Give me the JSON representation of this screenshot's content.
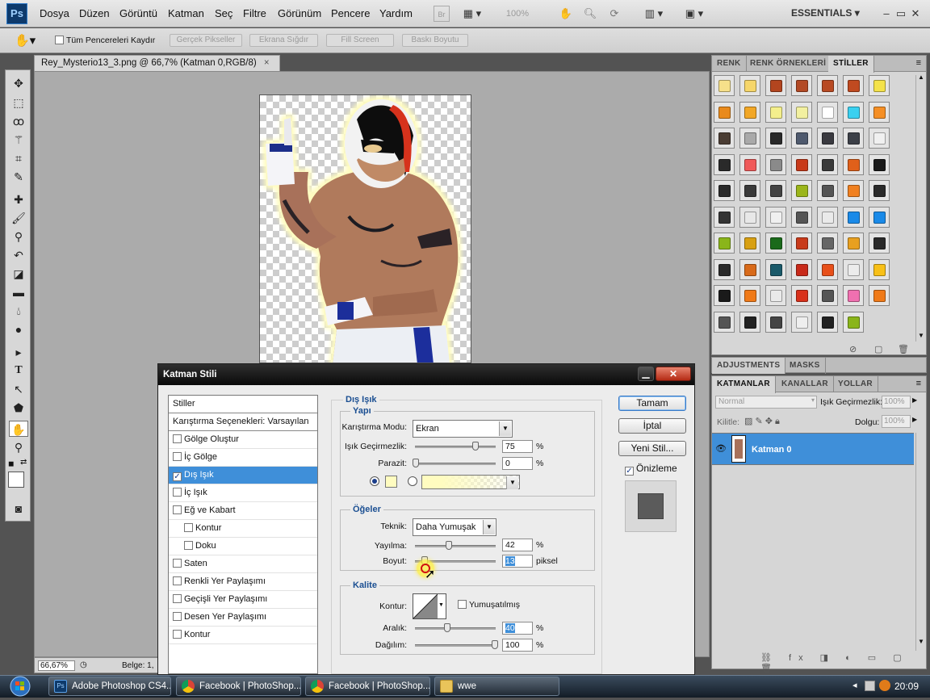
{
  "app": {
    "logo": "Ps",
    "menu": [
      "Dosya",
      "Düzen",
      "Görüntü",
      "Katman",
      "Seç",
      "Filtre",
      "Görünüm",
      "Pencere",
      "Yardım"
    ],
    "bridge_icon": "Br",
    "zoom_display": "100%",
    "workspace": "ESSENTIALS",
    "window_controls": [
      "–",
      "▭",
      "✕"
    ]
  },
  "options_bar": {
    "scroll_all_label": "Tüm Pencereleri Kaydır",
    "buttons": [
      "Gerçek Pikseller",
      "Ekrana Sığdır",
      "Fill Screen",
      "Baskı Boyutu"
    ]
  },
  "document": {
    "tab_title": "Rey_Mysterio13_3.png @ 66,7% (Katman 0,RGB/8)",
    "status_zoom": "66,67%",
    "status_doc": "Belge: 1,"
  },
  "tools": [
    "move-icon",
    "marquee-icon",
    "lasso-icon",
    "magic-wand-icon",
    "crop-icon",
    "eyedropper-icon",
    "healing-icon",
    "brush-icon",
    "stamp-icon",
    "history-brush-icon",
    "eraser-icon",
    "gradient-icon",
    "blur-icon",
    "dodge-icon",
    "pen-icon",
    "type-icon",
    "path-select-icon",
    "shape-icon",
    "hand-icon",
    "zoom-icon"
  ],
  "colors": {
    "foreground": "#ffffff",
    "background": "#ff00ff",
    "selection_blue": "#3f8fd9",
    "glow_color": "#fffcc0"
  },
  "styles_panel": {
    "tabs": [
      "RENK",
      "RENK ÖRNEKLERİ",
      "STİLLER"
    ],
    "active_tab": "STİLLER"
  },
  "adjustments_panel": {
    "tabs": [
      "ADJUSTMENTS",
      "MASKS"
    ]
  },
  "layers_panel": {
    "tabs": [
      "KATMANLAR",
      "KANALLAR",
      "YOLLAR"
    ],
    "blend_mode": "Normal",
    "opacity_label": "Işık Geçirmezlik:",
    "opacity_value": "100%",
    "lock_label": "Kilitle:",
    "fill_label": "Dolgu:",
    "fill_value": "100%",
    "layer_name": "Katman 0"
  },
  "dialog": {
    "title": "Katman Stili",
    "close": "✕",
    "list": [
      {
        "label": "Stiller",
        "checkbox": false,
        "checked": false,
        "indent": false,
        "selected": false
      },
      {
        "label": "Karıştırma Seçenekleri: Varsayılan",
        "checkbox": false,
        "checked": false,
        "indent": false,
        "selected": false
      },
      {
        "label": "Gölge Oluştur",
        "checkbox": true,
        "checked": false,
        "indent": false,
        "selected": false
      },
      {
        "label": "İç Gölge",
        "checkbox": true,
        "checked": false,
        "indent": false,
        "selected": false
      },
      {
        "label": "Dış Işık",
        "checkbox": true,
        "checked": true,
        "indent": false,
        "selected": true
      },
      {
        "label": "İç Işık",
        "checkbox": true,
        "checked": false,
        "indent": false,
        "selected": false
      },
      {
        "label": "Eğ ve Kabart",
        "checkbox": true,
        "checked": false,
        "indent": false,
        "selected": false
      },
      {
        "label": "Kontur",
        "checkbox": true,
        "checked": false,
        "indent": true,
        "selected": false
      },
      {
        "label": "Doku",
        "checkbox": true,
        "checked": false,
        "indent": true,
        "selected": false
      },
      {
        "label": "Saten",
        "checkbox": true,
        "checked": false,
        "indent": false,
        "selected": false
      },
      {
        "label": "Renkli Yer Paylaşımı",
        "checkbox": true,
        "checked": false,
        "indent": false,
        "selected": false
      },
      {
        "label": "Geçişli Yer Paylaşımı",
        "checkbox": true,
        "checked": false,
        "indent": false,
        "selected": false
      },
      {
        "label": "Desen Yer Paylaşımı",
        "checkbox": true,
        "checked": false,
        "indent": false,
        "selected": false
      },
      {
        "label": "Kontur",
        "checkbox": true,
        "checked": false,
        "indent": false,
        "selected": false
      }
    ],
    "section_title": "Dış Işık",
    "structure": {
      "title": "Yapı",
      "blend_mode_label": "Karıştırma Modu:",
      "blend_mode_value": "Ekran",
      "opacity_label": "Işık Geçirmezlik:",
      "opacity_value": "75",
      "noise_label": "Parazit:",
      "noise_value": "0",
      "percent": "%"
    },
    "elements": {
      "title": "Öğeler",
      "technique_label": "Teknik:",
      "technique_value": "Daha Yumuşak",
      "spread_label": "Yayılma:",
      "spread_value": "42",
      "size_label": "Boyut:",
      "size_value": "13",
      "size_unit": "piksel",
      "percent": "%"
    },
    "quality": {
      "title": "Kalite",
      "contour_label": "Kontur:",
      "antialias_label": "Yumuşatılmış",
      "range_label": "Aralık:",
      "range_value": "40",
      "jitter_label": "Dağılım:",
      "jitter_value": "100",
      "percent": "%"
    },
    "buttons": {
      "ok": "Tamam",
      "cancel": "İptal",
      "new_style": "Yeni Stil...",
      "preview_label": "Önizleme"
    }
  },
  "taskbar": {
    "items": [
      "Adobe Photoshop CS4...",
      "Facebook | PhotoShop...",
      "Facebook | PhotoShop...",
      "wwe"
    ],
    "clock": "20:09"
  }
}
